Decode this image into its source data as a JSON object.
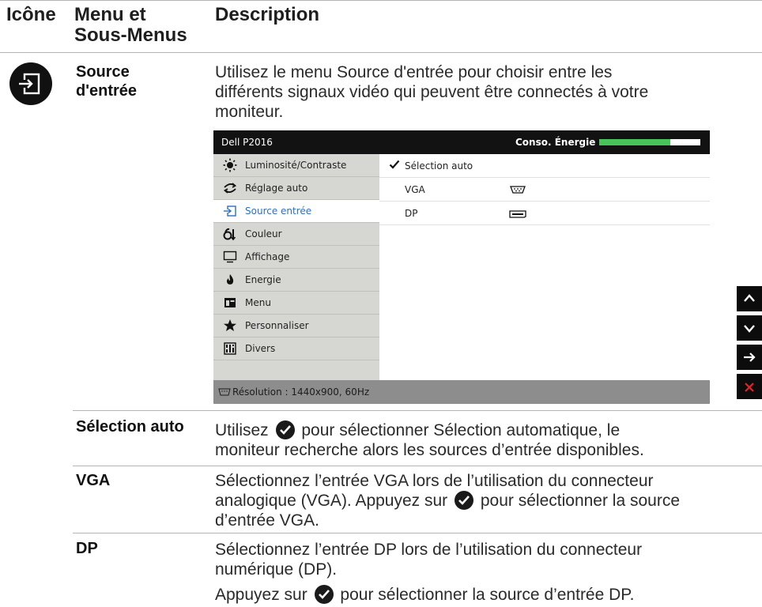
{
  "table": {
    "col_icon": "Icône",
    "col_menu_line1": "Menu et",
    "col_menu_line2": "Sous-Menus",
    "col_desc": "Description"
  },
  "source_row": {
    "name_line1": "Source",
    "name_line2": "d'entrée",
    "desc_line1": "Utilisez le menu Source d'entrée pour choisir entre les",
    "desc_line2": "différents signaux vidéo qui peuvent être connectés à votre",
    "desc_line3": "moniteur.",
    "icon": "input-source-icon"
  },
  "osd": {
    "model": "Dell P2016",
    "power_label": "Conso. Énergie",
    "power_level": 0.7,
    "menu_items": [
      {
        "label": "Luminosité/Contraste",
        "icon": "brightness-icon"
      },
      {
        "label": "Réglage auto",
        "icon": "auto-adjust-icon"
      },
      {
        "label": "Source entrée",
        "icon": "input-source-icon",
        "selected": true
      },
      {
        "label": "Couleur",
        "icon": "color-icon"
      },
      {
        "label": "Affichage",
        "icon": "display-icon"
      },
      {
        "label": "Energie",
        "icon": "energy-icon"
      },
      {
        "label": "Menu",
        "icon": "menu-icon"
      },
      {
        "label": "Personnaliser",
        "icon": "star-icon"
      },
      {
        "label": "Divers",
        "icon": "others-icon"
      }
    ],
    "sub_items": [
      {
        "label": "Sélection auto",
        "checked": true
      },
      {
        "label": "VGA",
        "connector": "vga-connector-icon"
      },
      {
        "label": "DP",
        "connector": "dp-connector-icon"
      }
    ],
    "resolution": "Résolution : 1440x900, 60Hz",
    "nav_buttons": [
      "up-arrow-icon",
      "down-arrow-icon",
      "right-arrow-icon",
      "close-icon"
    ],
    "accent_color": "#2b6fc4",
    "bar_color": "#47c45a",
    "close_color": "#e0242a"
  },
  "rows": {
    "auto": {
      "label": "Sélection auto",
      "line1_a": "Utilisez",
      "line1_b": "pour sélectionner Sélection automatique, le",
      "line2": "moniteur recherche alors les sources d’entrée disponibles."
    },
    "vga": {
      "label": "VGA",
      "line1": "Sélectionnez l’entrée VGA lors de l’utilisation du connecteur",
      "line2_a": "analogique (VGA). Appuyez sur",
      "line2_b": "pour sélectionner la source",
      "line3": "d’entrée VGA."
    },
    "dp": {
      "label": "DP",
      "line1": "Sélectionnez l’entrée DP lors de l’utilisation du connecteur",
      "line2": "numérique (DP).",
      "line3_a": "Appuyez sur",
      "line3_b": "pour sélectionner la source d’entrée DP."
    }
  }
}
